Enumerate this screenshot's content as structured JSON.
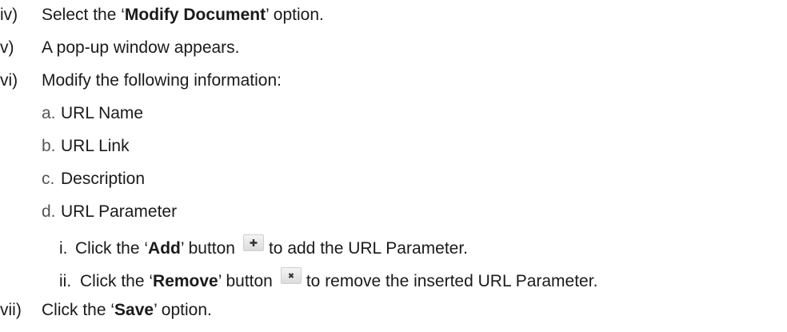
{
  "steps": {
    "iv": {
      "num": "iv)",
      "pre": "Select the ‘",
      "bold": "Modify Document",
      "post": "’ option."
    },
    "v": {
      "num": "v)",
      "text": "A pop-up window appears."
    },
    "vi": {
      "num": "vi)",
      "text": "Modify the following information:",
      "items": [
        {
          "letter": "a.",
          "text": "URL Name"
        },
        {
          "letter": "b.",
          "text": "URL Link"
        },
        {
          "letter": "c.",
          "text": "Description"
        },
        {
          "letter": "d.",
          "text": "URL Parameter"
        }
      ],
      "subitems": [
        {
          "num": "i.",
          "pre": "Click the ‘",
          "bold": "Add",
          "mid": "’ button",
          "icon": "plus-icon",
          "post": "to add the URL Parameter."
        },
        {
          "num": "ii.",
          "pre": "Click the ‘",
          "bold": "Remove",
          "mid": "’ button",
          "icon": "x-icon",
          "post": "to remove the inserted URL Parameter."
        }
      ]
    },
    "vii": {
      "num": "vii)",
      "pre": "Click the ‘",
      "bold": "Save",
      "post": "’ option."
    }
  }
}
